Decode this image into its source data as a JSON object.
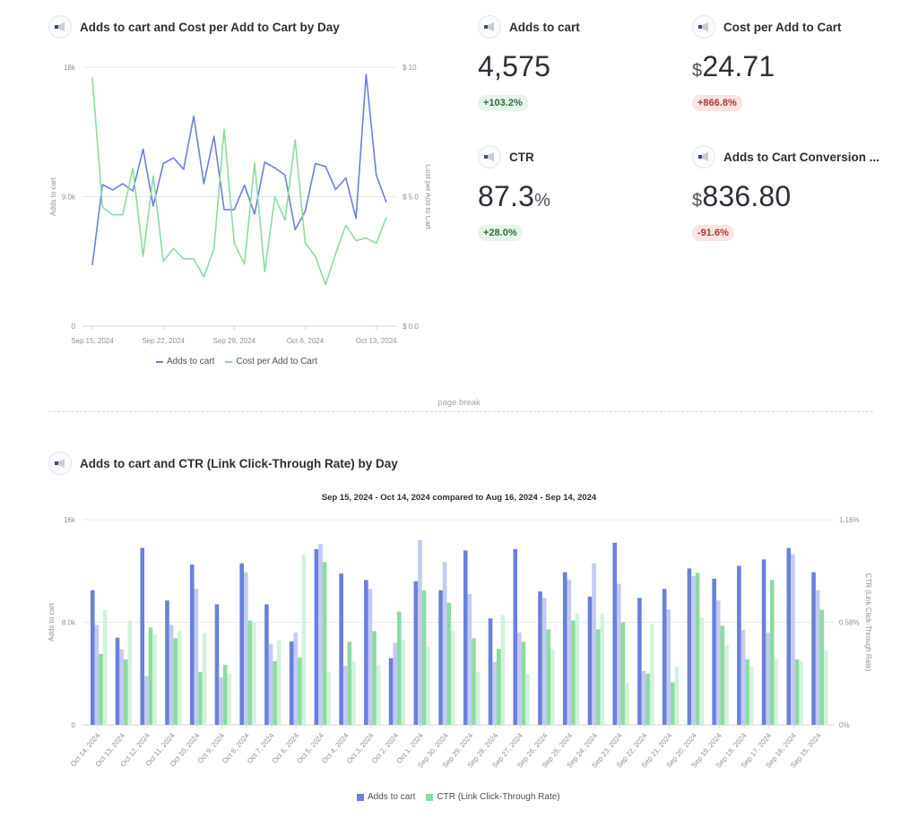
{
  "line_card": {
    "title": "Adds to cart and Cost per Add to Cart by Day",
    "icon": "megaphone-icon"
  },
  "kpis": [
    {
      "title": "Adds to cart",
      "icon": "megaphone-icon",
      "prefix": "",
      "value": "4,575",
      "suffix": "",
      "change": "+103.2%",
      "trend": "up"
    },
    {
      "title": "Cost per Add to Cart",
      "icon": "megaphone-icon",
      "prefix": "$",
      "value": "24.71",
      "suffix": "",
      "change": "+866.8%",
      "trend": "down"
    },
    {
      "title": "CTR",
      "icon": "megaphone-icon",
      "prefix": "",
      "value": "87.3",
      "suffix": "%",
      "change": "+28.0%",
      "trend": "up"
    },
    {
      "title": "Adds to Cart Conversion ...",
      "icon": "megaphone-icon",
      "prefix": "$",
      "value": "836.80",
      "suffix": "",
      "change": "-91.6%",
      "trend": "down"
    }
  ],
  "page_break_label": "page break",
  "bar_card": {
    "title": "Adds to cart and CTR (Link Click-Through Rate) by Day",
    "icon": "megaphone-icon",
    "subtitle": "Sep 15, 2024 - Oct 14, 2024 compared to Aug 16, 2024 - Sep 14, 2024"
  },
  "colors": {
    "adds": "#6b7fdb",
    "adds_prev": "#c3caf3",
    "ctr": "#8ddba1",
    "ctr_prev": "#d2f2da",
    "grid": "#e8eaed",
    "axis_text": "#8a9099"
  },
  "chart_data": [
    {
      "type": "line",
      "title": "Adds to cart and Cost per Add to Cart by Day",
      "xlabel": "",
      "ylabel": "Adds to cart",
      "y2label": "Cost per Add to Cart",
      "ylim": [
        0,
        18000
      ],
      "y2lim": [
        0,
        10
      ],
      "yticks": [
        "0",
        "9.0k",
        "18k"
      ],
      "y2ticks": [
        "$ 0.0",
        "$ 5.0",
        "$ 10"
      ],
      "xticks": [
        "Sep 15, 2024",
        "Sep 22, 2024",
        "Sep 29, 2024",
        "Oct 6, 2024",
        "Oct 13, 2024"
      ],
      "legend_position": "bottom",
      "grid": true,
      "x": [
        "Sep 15",
        "Sep 16",
        "Sep 17",
        "Sep 18",
        "Sep 19",
        "Sep 20",
        "Sep 21",
        "Sep 22",
        "Sep 23",
        "Sep 24",
        "Sep 25",
        "Sep 26",
        "Sep 27",
        "Sep 28",
        "Sep 29",
        "Sep 30",
        "Oct 1",
        "Oct 2",
        "Oct 3",
        "Oct 4",
        "Oct 5",
        "Oct 6",
        "Oct 7",
        "Oct 8",
        "Oct 9",
        "Oct 10",
        "Oct 11",
        "Oct 12",
        "Oct 13",
        "Oct 14"
      ],
      "series": [
        {
          "name": "Adds to cart",
          "axis": "left",
          "values": [
            4240,
            9840,
            9470,
            9900,
            9400,
            12300,
            8360,
            11300,
            11700,
            10900,
            14600,
            9900,
            13200,
            8100,
            8100,
            9800,
            7800,
            11400,
            11000,
            10500,
            6700,
            8000,
            11300,
            11100,
            9500,
            10300,
            7500,
            17500,
            10500,
            8600
          ]
        },
        {
          "name": "Cost per Add to Cart",
          "axis": "right",
          "values": [
            9.6,
            4.6,
            4.3,
            4.3,
            6.1,
            2.7,
            5.8,
            2.5,
            3.0,
            2.6,
            2.6,
            1.9,
            3.0,
            7.6,
            3.2,
            2.4,
            6.3,
            2.1,
            5.0,
            4.1,
            7.2,
            3.2,
            2.7,
            1.6,
            2.8,
            3.9,
            3.3,
            3.4,
            3.2,
            4.2
          ]
        }
      ]
    },
    {
      "type": "bar",
      "title": "Adds to cart and CTR (Link Click-Through Rate) by Day",
      "subtitle": "Sep 15, 2024 - Oct 14, 2024 compared to Aug 16, 2024 - Sep 14, 2024",
      "xlabel": "",
      "ylabel": "Adds to cart",
      "y2label": "CTR (Link Click-Through Rate)",
      "ylim": [
        0,
        16000
      ],
      "y2lim": [
        0,
        1.16
      ],
      "yticks": [
        "0",
        "8.0k",
        "16k"
      ],
      "y2ticks": [
        "0%",
        "0.58%",
        "1.16%"
      ],
      "legend_position": "bottom",
      "grid": true,
      "categories": [
        "Oct 14, 2024",
        "Oct 13, 2024",
        "Oct 12, 2024",
        "Oct 11, 2024",
        "Oct 10, 2024",
        "Oct 9, 2024",
        "Oct 8, 2024",
        "Oct 7, 2024",
        "Oct 6, 2024",
        "Oct 5, 2024",
        "Oct 4, 2024",
        "Oct 3, 2024",
        "Oct 2, 2024",
        "Oct 1, 2024",
        "Sep 30, 2024",
        "Sep 29, 2024",
        "Sep 28, 2024",
        "Sep 27, 2024",
        "Sep 26, 2024",
        "Sep 25, 2024",
        "Sep 24, 2024",
        "Sep 23, 2024",
        "Sep 22, 2024",
        "Sep 21, 2024",
        "Sep 20, 2024",
        "Sep 19, 2024",
        "Sep 18, 2024",
        "Sep 17, 2024",
        "Sep 16, 2024",
        "Sep 15, 2024"
      ],
      "series": [
        {
          "name": "Adds to cart",
          "axis": "left",
          "values": [
            10500,
            6800,
            13800,
            9700,
            12500,
            9400,
            12600,
            9400,
            6500,
            13700,
            11800,
            11300,
            5200,
            11200,
            10500,
            13600,
            8300,
            13700,
            10400,
            11900,
            10000,
            14200,
            9900,
            10600,
            12200,
            11400,
            12400,
            12900,
            13800,
            11900
          ]
        },
        {
          "name": "Adds to cart (previous period)",
          "axis": "left",
          "values": [
            7800,
            5900,
            3800,
            7800,
            10600,
            3700,
            11900,
            6300,
            7200,
            14100,
            4600,
            10600,
            6400,
            14400,
            12700,
            10200,
            4900,
            7200,
            9900,
            11300,
            12600,
            11000,
            4200,
            9000,
            11600,
            9700,
            7400,
            7200,
            13300,
            10500
          ]
        },
        {
          "name": "CTR (Link Click-Through Rate)",
          "axis": "right",
          "values": [
            0.4,
            0.37,
            0.55,
            0.49,
            0.3,
            0.34,
            0.59,
            0.36,
            0.38,
            0.92,
            0.47,
            0.53,
            0.64,
            0.76,
            0.69,
            0.49,
            0.43,
            0.47,
            0.54,
            0.59,
            0.54,
            0.58,
            0.29,
            0.24,
            0.86,
            0.56,
            0.37,
            0.82,
            0.37,
            0.65
          ]
        },
        {
          "name": "CTR (Link Click-Through Rate) (previous period)",
          "axis": "right",
          "values": [
            0.65,
            0.59,
            0.51,
            0.53,
            0.52,
            0.29,
            0.58,
            0.48,
            0.96,
            0.3,
            0.36,
            0.34,
            0.48,
            0.44,
            0.53,
            0.3,
            0.62,
            0.29,
            0.43,
            0.63,
            0.63,
            0.24,
            0.57,
            0.33,
            0.61,
            0.45,
            0.33,
            0.37,
            0.36,
            0.42
          ]
        }
      ],
      "legend": [
        "Adds to cart",
        "CTR (Link Click-Through Rate)"
      ]
    }
  ]
}
